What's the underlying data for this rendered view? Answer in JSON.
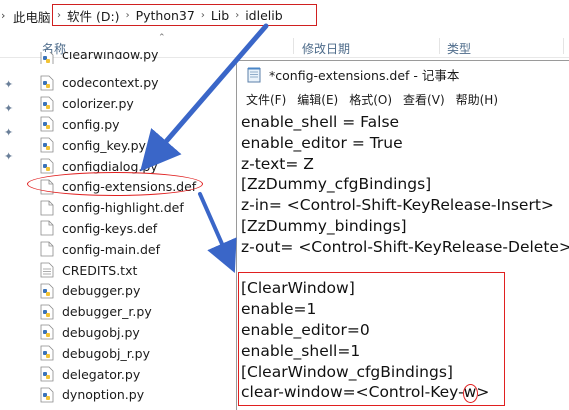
{
  "address_bar": {
    "this_pc": "此电脑",
    "crumbs": [
      "软件 (D:)",
      "Python37",
      "Lib",
      "idlelib"
    ]
  },
  "columns": {
    "name": "名称",
    "modified": "修改日期",
    "type": "类型"
  },
  "files": [
    {
      "name": "clearwindow.py",
      "icon": "python-file-icon"
    },
    {
      "name": "codecontext.py",
      "icon": "python-file-icon"
    },
    {
      "name": "colorizer.py",
      "icon": "python-file-icon"
    },
    {
      "name": "config.py",
      "icon": "python-file-icon"
    },
    {
      "name": "config_key.py",
      "icon": "python-file-icon"
    },
    {
      "name": "configdialog.py",
      "icon": "python-file-icon"
    },
    {
      "name": "config-extensions.def",
      "icon": "blank-file-icon"
    },
    {
      "name": "config-highlight.def",
      "icon": "blank-file-icon"
    },
    {
      "name": "config-keys.def",
      "icon": "blank-file-icon"
    },
    {
      "name": "config-main.def",
      "icon": "blank-file-icon"
    },
    {
      "name": "CREDITS.txt",
      "icon": "text-file-icon"
    },
    {
      "name": "debugger.py",
      "icon": "python-file-icon"
    },
    {
      "name": "debugger_r.py",
      "icon": "python-file-icon"
    },
    {
      "name": "debugobj.py",
      "icon": "python-file-icon"
    },
    {
      "name": "debugobj_r.py",
      "icon": "python-file-icon"
    },
    {
      "name": "delegator.py",
      "icon": "python-file-icon"
    },
    {
      "name": "dynoption.py",
      "icon": "python-file-icon"
    }
  ],
  "notepad": {
    "title": "*config-extensions.def - 记事本",
    "menu": [
      "文件(F)",
      "编辑(E)",
      "格式(O)",
      "查看(V)",
      "帮助(H)"
    ],
    "lines": [
      "enable_shell = False",
      "enable_editor = True",
      "z-text= Z",
      "[ZzDummy_cfgBindings]",
      "z-in= <Control-Shift-KeyRelease-Insert>",
      "[ZzDummy_bindings]",
      "z-out= <Control-Shift-KeyRelease-Delete>",
      "",
      "[ClearWindow]",
      "enable=1",
      "enable_editor=0",
      "enable_shell=1",
      "[ClearWindow_cfgBindings]",
      "clear-window=<Control-Key-w>"
    ]
  },
  "colors": {
    "annotation_red": "#e02020",
    "arrow_blue": "#3a66c8"
  }
}
